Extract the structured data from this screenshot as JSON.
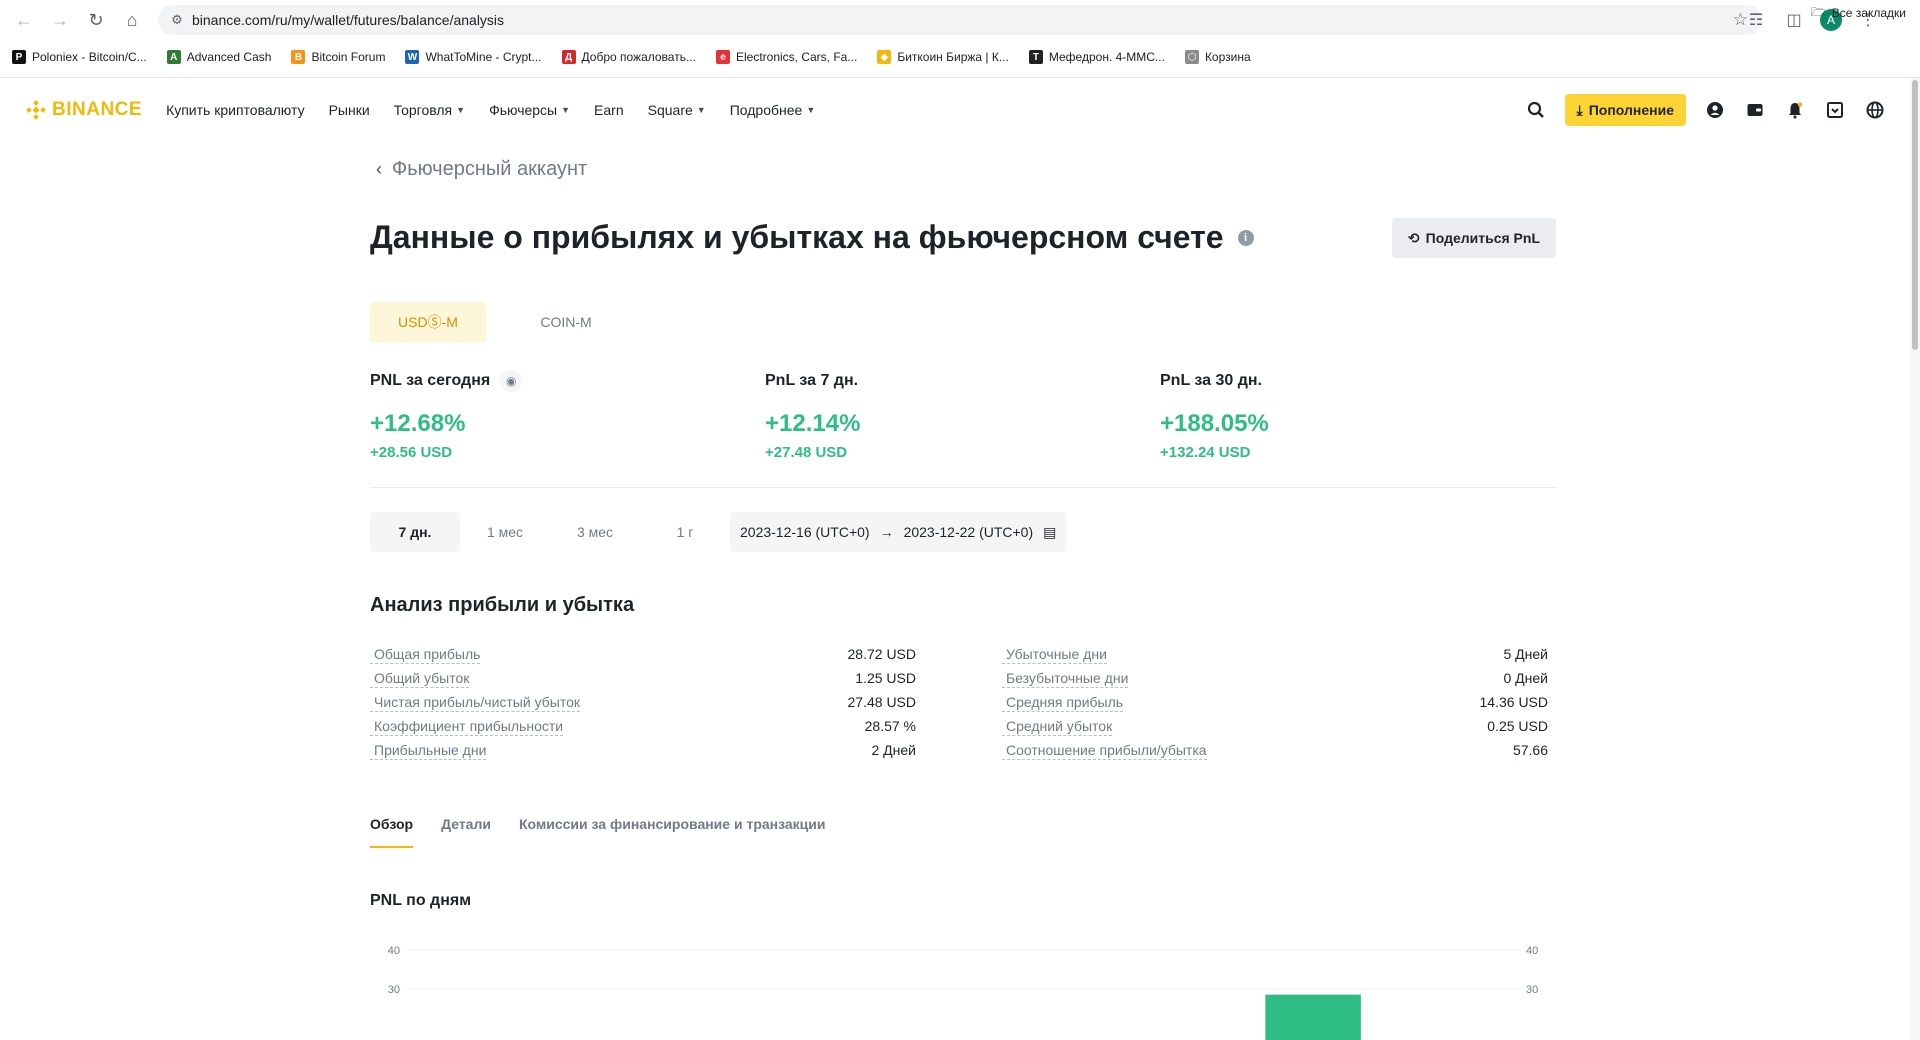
{
  "browser": {
    "url": "binance.com/ru/my/wallet/futures/balance/analysis",
    "avatar_letter": "A",
    "bookmarks": [
      {
        "label": "Poloniex - Bitcoin/C...",
        "color": "#111111",
        "glyph": "P"
      },
      {
        "label": "Advanced Cash",
        "color": "#2e7d32",
        "glyph": "A"
      },
      {
        "label": "Bitcoin Forum",
        "color": "#f7931a",
        "glyph": "B"
      },
      {
        "label": "WhatToMine - Crypt...",
        "color": "#1e63b6",
        "glyph": "W"
      },
      {
        "label": "Добро пожаловать...",
        "color": "#d62828",
        "glyph": "Д"
      },
      {
        "label": "Electronics, Cars, Fa...",
        "color": "#e53238",
        "glyph": "e"
      },
      {
        "label": "Биткоин Биржа | К...",
        "color": "#f0b90b",
        "glyph": "◆"
      },
      {
        "label": "Мефедрон. 4-MMC...",
        "color": "#222222",
        "glyph": "T"
      },
      {
        "label": "Корзина",
        "color": "#8a8a8a",
        "glyph": "⬡"
      }
    ],
    "all_bookmarks": "Все закладки"
  },
  "header": {
    "logo": "BINANCE",
    "nav": [
      {
        "label": "Купить криптовалюту",
        "dropdown": false
      },
      {
        "label": "Рынки",
        "dropdown": false
      },
      {
        "label": "Торговля",
        "dropdown": true
      },
      {
        "label": "Фьючерсы",
        "dropdown": true
      },
      {
        "label": "Earn",
        "dropdown": false
      },
      {
        "label": "Square",
        "dropdown": true
      },
      {
        "label": "Подробнее",
        "dropdown": true
      }
    ],
    "deposit_label": "Пополнение",
    "accent": "#fcd535"
  },
  "page": {
    "back_label": "Фьючерсный аккаунт",
    "title": "Данные о прибылях и убытках на фьючерсном счете",
    "share_label": "Поделиться PnL",
    "account_tabs": [
      {
        "label": "USDⓈ-M",
        "active": true
      },
      {
        "label": "COIN-M",
        "active": false
      }
    ],
    "pnl": [
      {
        "label": "PNL за сегодня",
        "pct": "+12.68%",
        "usd": "+28.56 USD",
        "eye": true
      },
      {
        "label": "PnL за 7 дн.",
        "pct": "+12.14%",
        "usd": "+27.48 USD",
        "eye": false
      },
      {
        "label": "PnL за 30 дн.",
        "pct": "+188.05%",
        "usd": "+132.24 USD",
        "eye": false
      }
    ],
    "periods": [
      {
        "label": "7 дн.",
        "active": true
      },
      {
        "label": "1 мес",
        "active": false
      },
      {
        "label": "3 мес",
        "active": false
      },
      {
        "label": "1 г",
        "active": false
      }
    ],
    "date_start": "2023-12-16 (UTC+0)",
    "date_end": "2023-12-22 (UTC+0)",
    "analysis_title": "Анализ прибыли и убытка",
    "stats_left": [
      {
        "label": "Общая прибыль",
        "value": "28.72 USD"
      },
      {
        "label": "Общий убыток",
        "value": "1.25 USD"
      },
      {
        "label": "Чистая прибыль/чистый убыток",
        "value": "27.48 USD"
      },
      {
        "label": "Коэффициент прибыльности",
        "value": "28.57 %"
      },
      {
        "label": "Прибыльные дни",
        "value": "2 Дней"
      }
    ],
    "stats_right": [
      {
        "label": "Убыточные дни",
        "value": "5 Дней"
      },
      {
        "label": "Безубыточные дни",
        "value": "0 Дней"
      },
      {
        "label": "Средняя прибыль",
        "value": "14.36 USD"
      },
      {
        "label": "Средний убыток",
        "value": "0.25 USD"
      },
      {
        "label": "Соотношение прибыли/убытка",
        "value": "57.66"
      }
    ],
    "view_tabs": [
      {
        "label": "Обзор",
        "active": true
      },
      {
        "label": "Детали",
        "active": false
      },
      {
        "label": "Комиссии за финансирование и транзакции",
        "active": false
      }
    ],
    "chart_title": "PNL по дням",
    "positive_color": "#2ebd85"
  },
  "chart_data": {
    "type": "bar",
    "title": "PNL по дням",
    "y_ticks_left": [
      40,
      30
    ],
    "y_ticks_right": [
      40,
      30
    ],
    "series": [
      {
        "values": [
          0,
          0,
          0,
          0,
          0,
          28.56,
          0
        ]
      }
    ],
    "ylim": [
      0,
      40
    ]
  }
}
